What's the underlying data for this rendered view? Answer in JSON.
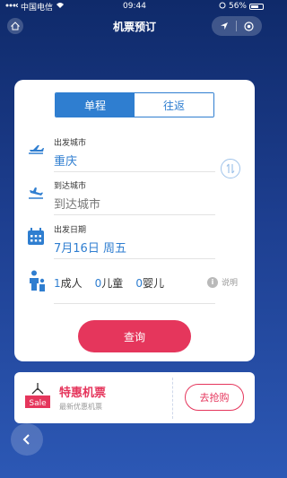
{
  "status_bar": {
    "carrier": "中国电信",
    "time": "09:44",
    "battery": "56%"
  },
  "nav": {
    "title": "机票预订"
  },
  "tabs": {
    "one_way": "单程",
    "round_trip": "往返",
    "active": "one_way"
  },
  "depart_city": {
    "label": "出发城市",
    "value": "重庆"
  },
  "arrive_city": {
    "label": "到达城市",
    "placeholder": "到达城市"
  },
  "depart_date": {
    "label": "出发日期",
    "value": "7月16日 周五"
  },
  "passengers": {
    "adults_count": "1",
    "adults_label": "成人",
    "children_count": "0",
    "children_label": "儿童",
    "infants_count": "0",
    "infants_label": "婴儿",
    "explain_label": "说明"
  },
  "query_button": "查询",
  "promo": {
    "title": "特惠机票",
    "subtitle": "最新优惠机票",
    "button": "去抢购",
    "icon_text": "Sale"
  },
  "colors": {
    "accent_blue": "#2f7ed0",
    "accent_red": "#e5365c"
  }
}
